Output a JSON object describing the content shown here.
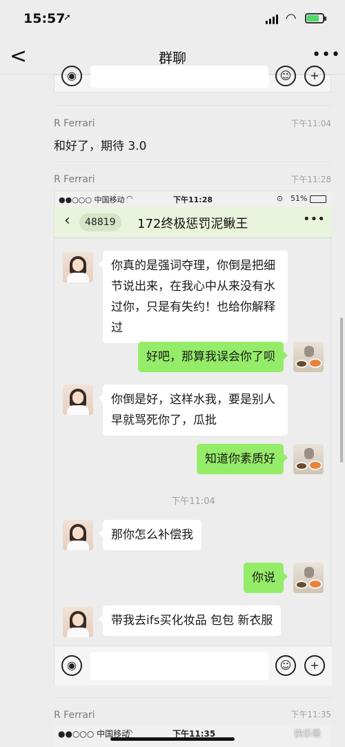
{
  "status_bar": {
    "time": "15:57",
    "location_arrow": "➚"
  },
  "nav": {
    "back": "<",
    "title": "群聊",
    "more": "•••"
  },
  "feed": {
    "msg1": {
      "sender": "R Ferrari",
      "time": "下午11:04",
      "text": "和好了，期待 3.0"
    },
    "msg2": {
      "sender": "R Ferrari",
      "time": "下午11:28"
    },
    "msg3": {
      "sender": "R Ferrari",
      "time": "下午11:35"
    }
  },
  "screenshot": {
    "status": {
      "carrier": "●●○○○ 中国移动",
      "time": "下午11:28",
      "battery": "51%"
    },
    "nav": {
      "badge": "48819",
      "title": "172终极惩罚泥鳅王",
      "more": "•••"
    },
    "messages": [
      {
        "side": "left",
        "text": "你真的是强词夺理，你倒是把细节说出来，在我心中从来没有水过你，只是有失约！也给你解释过"
      },
      {
        "side": "right",
        "text": "好吧，那算我误会你了呗"
      },
      {
        "side": "left",
        "text": "你倒是好，这样水我，要是别人早就骂死你了，瓜批"
      },
      {
        "side": "right",
        "text": "知道你素质好"
      },
      {
        "side": "left",
        "text": "那你怎么补偿我"
      },
      {
        "side": "right",
        "text": "你说"
      },
      {
        "side": "left",
        "text": "带我去ifs买化妆品 包包 新衣服"
      }
    ],
    "time_divider": "下午11:04"
  },
  "bottom_screenshot": {
    "carrier": "●●○○○ 中国移动",
    "time": "下午11:35"
  },
  "watermark": "快乐晕"
}
